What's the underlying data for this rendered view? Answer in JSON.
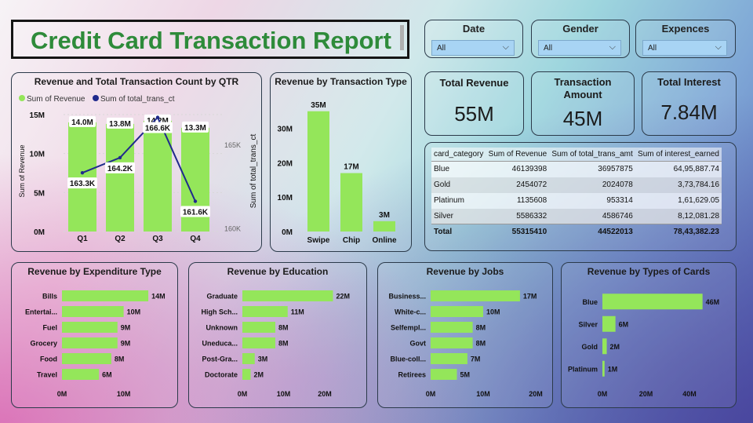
{
  "report_title": "Credit Card Transaction Report",
  "slicers": [
    {
      "label": "Date",
      "value": "All"
    },
    {
      "label": "Gender",
      "value": "All"
    },
    {
      "label": "Expences",
      "value": "All"
    }
  ],
  "kpis": {
    "total_revenue": {
      "label": "Total Revenue",
      "value": "55M"
    },
    "transaction_amount": {
      "label": "Transaction Amount",
      "value": "45M"
    },
    "total_interest": {
      "label": "Total Interest",
      "value": "7.84M"
    }
  },
  "colors": {
    "bar": "#94e65a",
    "line": "#1f2a8c",
    "title": "#2e8b3a"
  },
  "table": {
    "columns": [
      "card_category",
      "Sum of Revenue",
      "Sum of total_trans_amt",
      "Sum of interest_earned"
    ],
    "rows": [
      [
        "Blue",
        "46139398",
        "36957875",
        "64,95,887.74"
      ],
      [
        "Gold",
        "2454072",
        "2024078",
        "3,73,784.16"
      ],
      [
        "Platinum",
        "1135608",
        "953314",
        "1,61,629.05"
      ],
      [
        "Silver",
        "5586332",
        "4586746",
        "8,12,081.28"
      ]
    ],
    "total": [
      "Total",
      "55315410",
      "44522013",
      "78,43,382.23"
    ]
  },
  "chart_data": [
    {
      "type": "bar",
      "title": "Revenue and Total Transaction Count by QTR",
      "categories": [
        "Q1",
        "Q2",
        "Q3",
        "Q4"
      ],
      "legend": [
        "Sum of Revenue",
        "Sum of total_trans_ct"
      ],
      "ylabel": "Sum of Revenue",
      "y2label": "Sum of total_trans_ct",
      "yticks": [
        "0M",
        "5M",
        "10M",
        "15M"
      ],
      "y2ticks": [
        "160K",
        "165K"
      ],
      "ylim": [
        0,
        15.5
      ],
      "y2lim": [
        159.8,
        167
      ],
      "series": [
        {
          "name": "Sum of Revenue",
          "values": [
            14.0,
            13.8,
            14.2,
            13.3
          ],
          "labels": [
            "14.0M",
            "13.8M",
            "14.2M",
            "13.3M"
          ]
        },
        {
          "name": "Sum of total_trans_ct",
          "values": [
            163.3,
            164.2,
            166.6,
            161.6
          ],
          "labels": [
            "163.3K",
            "164.2K",
            "166.6K",
            "161.6K"
          ]
        }
      ]
    },
    {
      "type": "bar",
      "title": "Revenue by Transaction Type",
      "categories": [
        "Swipe",
        "Chip",
        "Online"
      ],
      "values": [
        35,
        17,
        3
      ],
      "labels": [
        "35M",
        "17M",
        "3M"
      ],
      "yticks": [
        "0M",
        "10M",
        "20M",
        "30M"
      ],
      "ylim": [
        0,
        37
      ]
    },
    {
      "type": "bar",
      "title": "Revenue by Expenditure Type",
      "categories": [
        "Bills",
        "Entertai...",
        "Fuel",
        "Grocery",
        "Food",
        "Travel"
      ],
      "values": [
        14,
        10,
        9,
        9,
        8,
        6
      ],
      "labels": [
        "14M",
        "10M",
        "9M",
        "9M",
        "8M",
        "6M"
      ],
      "xticks": [
        "0M",
        "10M"
      ],
      "xlim": [
        0,
        14.5
      ]
    },
    {
      "type": "bar",
      "title": "Revenue by Education",
      "categories": [
        "Graduate",
        "High Sch...",
        "Unknown",
        "Uneduca...",
        "Post-Gra...",
        "Doctorate"
      ],
      "values": [
        22,
        11,
        8,
        8,
        3,
        2
      ],
      "labels": [
        "22M",
        "11M",
        "8M",
        "8M",
        "3M",
        "2M"
      ],
      "xticks": [
        "0M",
        "10M",
        "20M"
      ],
      "xlim": [
        0,
        24
      ]
    },
    {
      "type": "bar",
      "title": "Revenue by Jobs",
      "categories": [
        "Business...",
        "White-c...",
        "Selfempl...",
        "Govt",
        "Blue-coll...",
        "Retirees"
      ],
      "values": [
        17,
        10,
        8,
        8,
        7,
        5
      ],
      "labels": [
        "17M",
        "10M",
        "8M",
        "8M",
        "7M",
        "5M"
      ],
      "xticks": [
        "0M",
        "10M",
        "20M"
      ],
      "xlim": [
        0,
        20
      ]
    },
    {
      "type": "bar",
      "title": "Revenue by Types of Cards",
      "categories": [
        "Blue",
        "Silver",
        "Gold",
        "Platinum"
      ],
      "values": [
        46,
        6,
        2,
        1
      ],
      "labels": [
        "46M",
        "6M",
        "2M",
        "1M"
      ],
      "xticks": [
        "0M",
        "20M",
        "40M"
      ],
      "xlim": [
        0,
        49
      ]
    }
  ]
}
